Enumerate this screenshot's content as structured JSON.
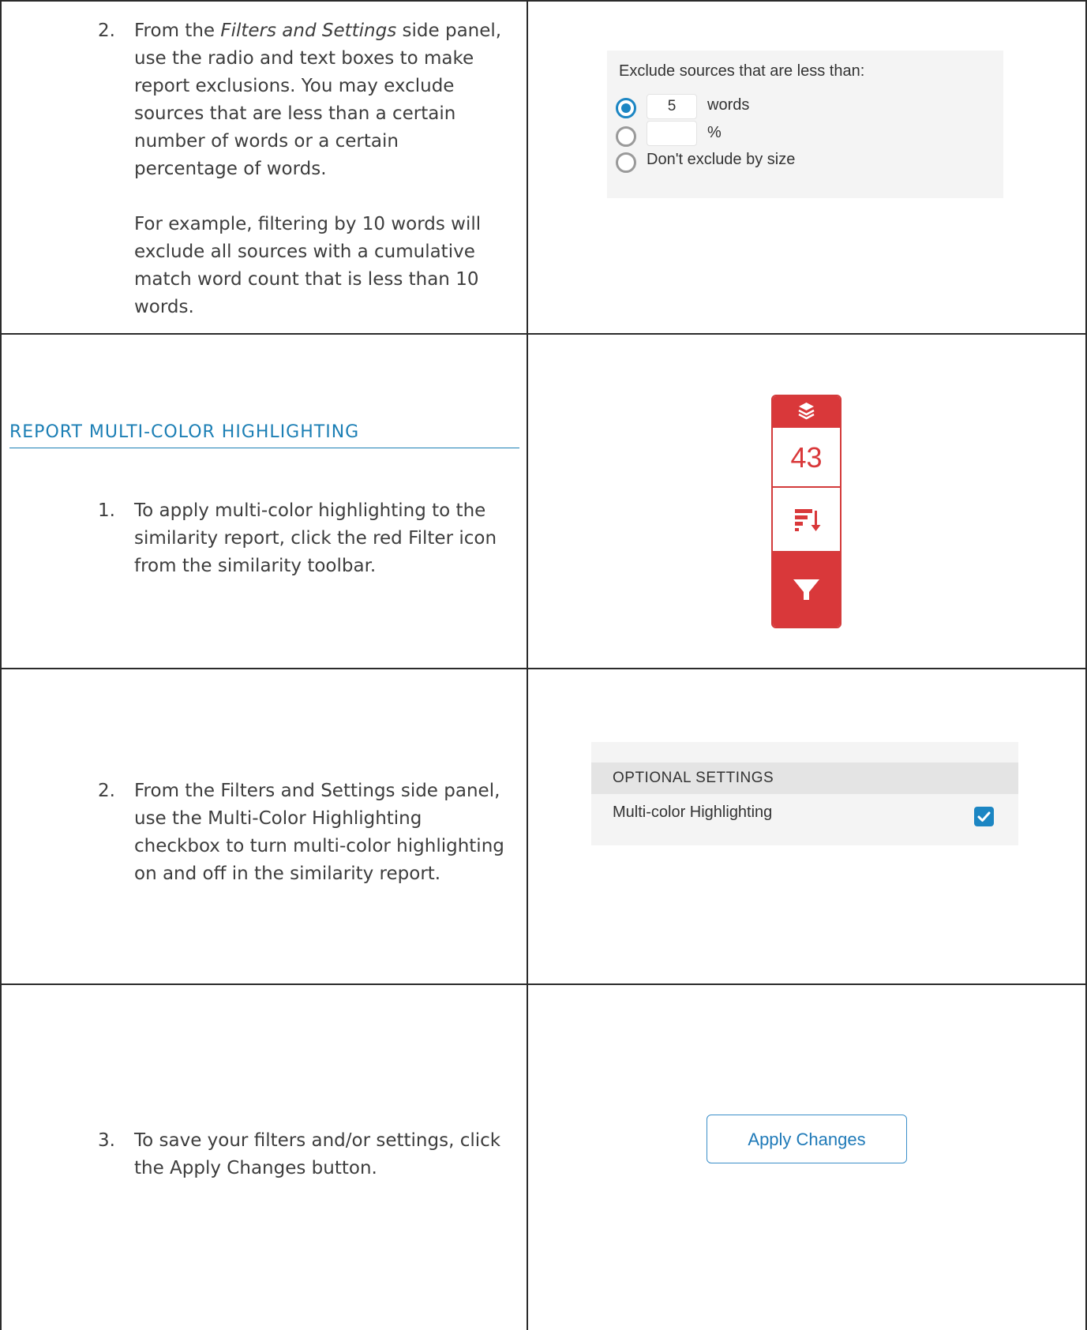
{
  "row1": {
    "num": "2.",
    "text_before": "From the ",
    "text_em": "Filters and Settings",
    "text_line1_after": " side panel,",
    "line2": "use the radio and text boxes to make",
    "line3": "report exclusions. You may exclude",
    "line4": "sources that are less than a certain",
    "line5": "number of words or a certain",
    "line6": "percentage of words.",
    "example_line1": "For example, filtering by 10 words will",
    "example_line2": "exclude all sources with a cumulative",
    "example_line3": "match word count that is less than 10",
    "example_line4": "words."
  },
  "exclude_panel": {
    "title": "Exclude sources that are less than:",
    "words_value": "5",
    "words_label": "words",
    "percent_value": "",
    "percent_label": "%",
    "dont_exclude_label": "Don't exclude by size",
    "selected_option": "words"
  },
  "section": {
    "heading": "REPORT MULTI-COLOR HIGHLIGHTING"
  },
  "row2": {
    "num": "1.",
    "line1": "To apply multi-color highlighting to the",
    "line2": "similarity report, click the red Filter icon",
    "line3": "from the similarity toolbar."
  },
  "toolbar": {
    "score": "43",
    "accent_color": "#d9383a",
    "icons": [
      "layers-icon",
      "sort-icon",
      "filter-icon"
    ]
  },
  "row3": {
    "num": "2.",
    "line1": "From the Filters and Settings side panel,",
    "line2": "use the Multi-Color Highlighting",
    "line3": "checkbox to turn multi-color highlighting",
    "line4": "on and off in the similarity report."
  },
  "optional_settings": {
    "heading": "OPTIONAL SETTINGS",
    "multi_color_label": "Multi-color Highlighting",
    "multi_color_checked": true
  },
  "row4": {
    "num": "3.",
    "line1": "To save your filters and/or settings, click",
    "line2": "the Apply Changes button."
  },
  "apply": {
    "label": "Apply Changes"
  }
}
